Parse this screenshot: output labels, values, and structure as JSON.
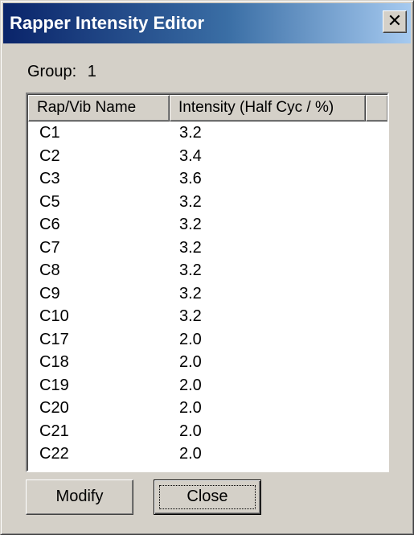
{
  "window": {
    "title": "Rapper Intensity Editor",
    "close_glyph": "✕",
    "close_icon": "close-icon"
  },
  "group": {
    "label": "Group:",
    "value": "1"
  },
  "list": {
    "columns": [
      "Rap/Vib Name",
      "Intensity (Half Cyc / %)"
    ],
    "rows": [
      {
        "name": "C1",
        "intensity": "3.2"
      },
      {
        "name": "C2",
        "intensity": "3.4"
      },
      {
        "name": "C3",
        "intensity": "3.6"
      },
      {
        "name": "C5",
        "intensity": "3.2"
      },
      {
        "name": "C6",
        "intensity": "3.2"
      },
      {
        "name": "C7",
        "intensity": "3.2"
      },
      {
        "name": "C8",
        "intensity": "3.2"
      },
      {
        "name": "C9",
        "intensity": "3.2"
      },
      {
        "name": "C10",
        "intensity": "3.2"
      },
      {
        "name": "C17",
        "intensity": "2.0"
      },
      {
        "name": "C18",
        "intensity": "2.0"
      },
      {
        "name": "C19",
        "intensity": "2.0"
      },
      {
        "name": "C20",
        "intensity": "2.0"
      },
      {
        "name": "C21",
        "intensity": "2.0"
      },
      {
        "name": "C22",
        "intensity": "2.0"
      }
    ]
  },
  "buttons": {
    "modify": "Modify",
    "close": "Close"
  },
  "colors": {
    "title_start": "#0a246a",
    "title_end": "#a6caf0",
    "face": "#d4d0c8"
  }
}
